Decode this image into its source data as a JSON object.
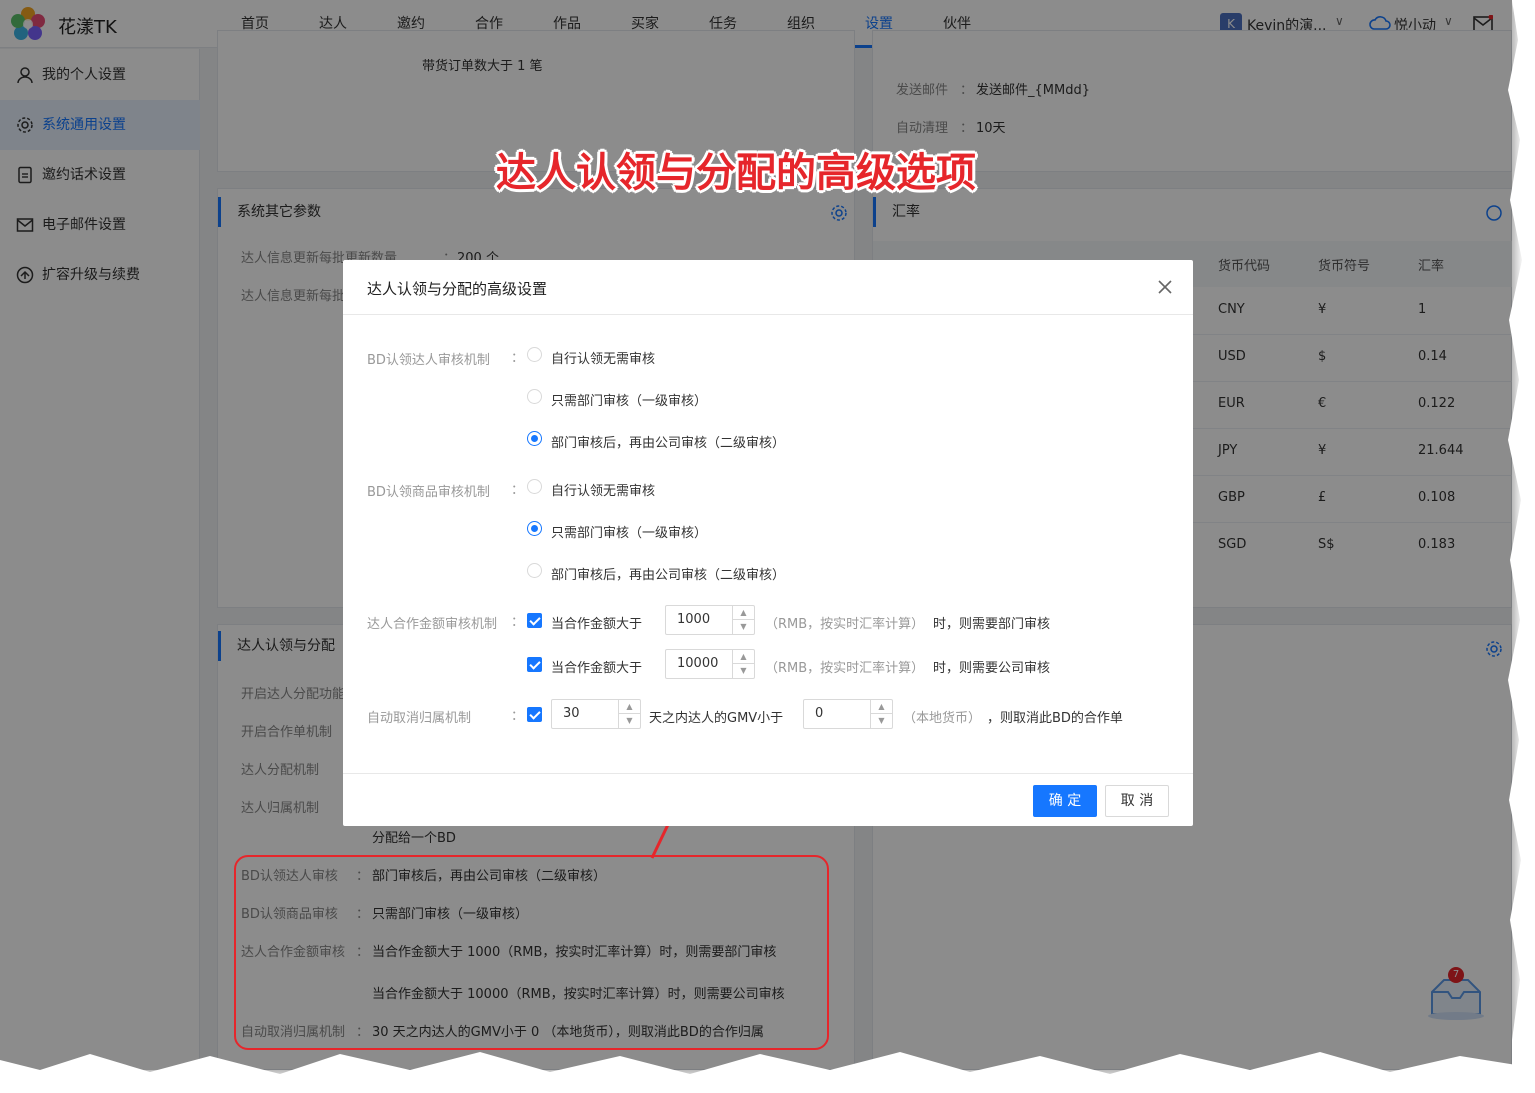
{
  "app": {
    "brand": "花漾TK"
  },
  "nav": {
    "items": [
      "首页",
      "达人",
      "邀约",
      "合作",
      "作品",
      "买家",
      "任务",
      "组织",
      "设置",
      "伙伴"
    ],
    "active": "设置",
    "user_initial": "K",
    "user_name": "Kevin的演...",
    "assistant_name": "悦小动",
    "chevron": "∨"
  },
  "sidebar": {
    "items": [
      {
        "label": "我的个人设置",
        "icon": "user-icon"
      },
      {
        "label": "系统通用设置",
        "icon": "gear-icon",
        "active": true
      },
      {
        "label": "邀约话术设置",
        "icon": "document-icon"
      },
      {
        "label": "电子邮件设置",
        "icon": "mail-icon"
      },
      {
        "label": "扩容升级与续费",
        "icon": "upgrade-icon"
      }
    ]
  },
  "card_top_left": {
    "text": "带货订单数大于 1 笔"
  },
  "card_top_right": {
    "rows": [
      {
        "label": "发送邮件",
        "colon": "：",
        "value": "发送邮件_{MMdd}"
      },
      {
        "label": "自动清理",
        "colon": "：",
        "value": "10天"
      }
    ]
  },
  "card_system": {
    "title": "系统其它参数",
    "rows": [
      {
        "label": "达人信息更新每批更新数量",
        "colon": "：",
        "value": "200 个"
      },
      {
        "label": "达人信息更新每批"
      }
    ]
  },
  "card_rate": {
    "title": "汇率",
    "headers": [
      "货币代码",
      "货币符号",
      "汇率"
    ],
    "rows": [
      [
        "CNY",
        "¥",
        "1"
      ],
      [
        "USD",
        "$",
        "0.14"
      ],
      [
        "EUR",
        "€",
        "0.122"
      ],
      [
        "JPY",
        "¥",
        "21.644"
      ],
      [
        "GBP",
        "£",
        "0.108"
      ],
      [
        "SGD",
        "S$",
        "0.183"
      ]
    ]
  },
  "card_assign": {
    "title": "达人认领与分配",
    "rows": [
      "开启达人分配功能",
      "开启合作单机制",
      "达人分配机制",
      "达人归属机制"
    ],
    "assign_value": "分配给一个BD",
    "summary": [
      {
        "label": "BD认领达人审核",
        "colon": "：",
        "value": "部门审核后，再由公司审核（二级审核）"
      },
      {
        "label": "BD认领商品审核",
        "colon": "：",
        "value": "只需部门审核（一级审核）"
      },
      {
        "label": "达人合作金额审核",
        "colon": "：",
        "value": "当合作金额大于 1000（RMB，按实时汇率计算）时，则需要部门审核"
      },
      {
        "label": "",
        "colon": "",
        "value": "当合作金额大于 10000（RMB，按实时汇率计算）时，则需要公司审核"
      },
      {
        "label": "自动取消归属机制",
        "colon": "：",
        "value": "30 天之内达人的GMV小于 0 （本地货币），则取消此BD的合作归属"
      }
    ]
  },
  "annotation": {
    "text": "达人认领与分配的高级选项"
  },
  "modal": {
    "title": "达人认领与分配的高级设置",
    "colon": "：",
    "creator_review": {
      "label": "BD认领达人审核机制",
      "options": [
        "自行认领无需审核",
        "只需部门审核（一级审核）",
        "部门审核后，再由公司审核（二级审核）"
      ],
      "selected": 2
    },
    "product_review": {
      "label": "BD认领商品审核机制",
      "options": [
        "自行认领无需审核",
        "只需部门审核（一级审核）",
        "部门审核后，再由公司审核（二级审核）"
      ],
      "selected": 1
    },
    "amount_review": {
      "label": "达人合作金额审核机制",
      "rows": [
        {
          "checked": true,
          "prefix": "当合作金额大于",
          "value": "1000",
          "hint": "（RMB，按实时汇率计算）",
          "suffix": "时，则需要部门审核"
        },
        {
          "checked": true,
          "prefix": "当合作金额大于",
          "value": "10000",
          "hint": "（RMB，按实时汇率计算）",
          "suffix": "时，则需要公司审核"
        }
      ]
    },
    "auto_cancel": {
      "label": "自动取消归属机制",
      "checked": true,
      "days": "30",
      "middle": "天之内达人的GMV小于",
      "gmv": "0",
      "hint": "（本地货币）",
      "suffix": "，则取消此BD的合作单"
    },
    "ok_label": "确 定",
    "cancel_label": "取 消"
  },
  "float_widget": {
    "badge": "7"
  },
  "colors": {
    "primary": "#1677ff",
    "annotation": "#e6262b"
  }
}
